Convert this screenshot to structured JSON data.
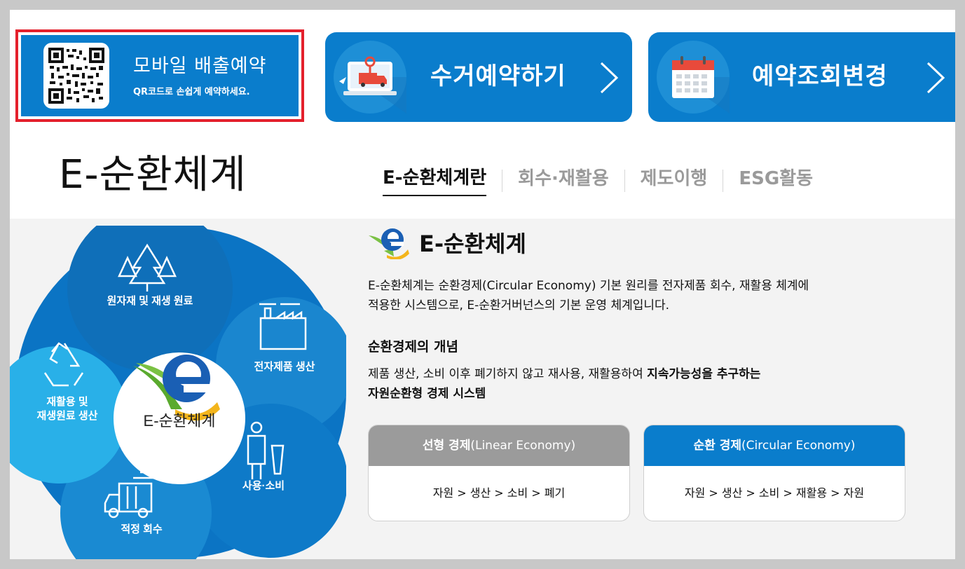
{
  "mobile_reservation": {
    "title": "모바일 배출예약",
    "subtitle": "QR코드로 손쉽게 예약하세요."
  },
  "buttons": {
    "pickup_label": "수거예약하기",
    "lookup_label": "예약조회변경"
  },
  "page_title": "E-순환체계",
  "tabs": [
    {
      "label": "E-순환체계란",
      "active": true
    },
    {
      "label": "회수·재활용",
      "active": false
    },
    {
      "label": "제도이행",
      "active": false
    },
    {
      "label": "ESG활동",
      "active": false
    }
  ],
  "diagram": {
    "center_label": "E-순환체계",
    "segments": {
      "raw_material": "원자재 및 재생 원료",
      "production": "전자제품 생산",
      "use": "사용·소비",
      "collection": "적정 회수",
      "recycling_line1": "재활용 및",
      "recycling_line2": "재생원료 생산"
    }
  },
  "content": {
    "title": "E-순환체계",
    "intro_line1": "E-순환체계는 순환경제(Circular Economy) 기본 원리를 전자제품 회수, 재활용 체계에",
    "intro_line2": "적용한 시스템으로, E-순환거버넌스의 기본 운영 체계입니다.",
    "concept_heading": "순환경제의 개념",
    "concept_line1_plain": "제품 생산, 소비 이후 폐기하지 않고 재사용, 재활용하여 ",
    "concept_line1_bold": "지속가능성을 추구하는",
    "concept_line2_bold": "자원순환형 경제 시스템"
  },
  "cards": {
    "linear": {
      "head_bold": "선형 경제",
      "head_rest": "(Linear Economy)",
      "flow": "자원 > 생산 > 소비 > 폐기"
    },
    "circular": {
      "head_bold": "순환 경제",
      "head_rest": "(Circular Economy)",
      "flow": "자원 > 생산 > 소비 > 재활용 > 자원"
    }
  },
  "colors": {
    "primary_blue": "#0a7dcc",
    "highlight_red": "#e4202c",
    "gray_head": "#9b9b9b"
  }
}
